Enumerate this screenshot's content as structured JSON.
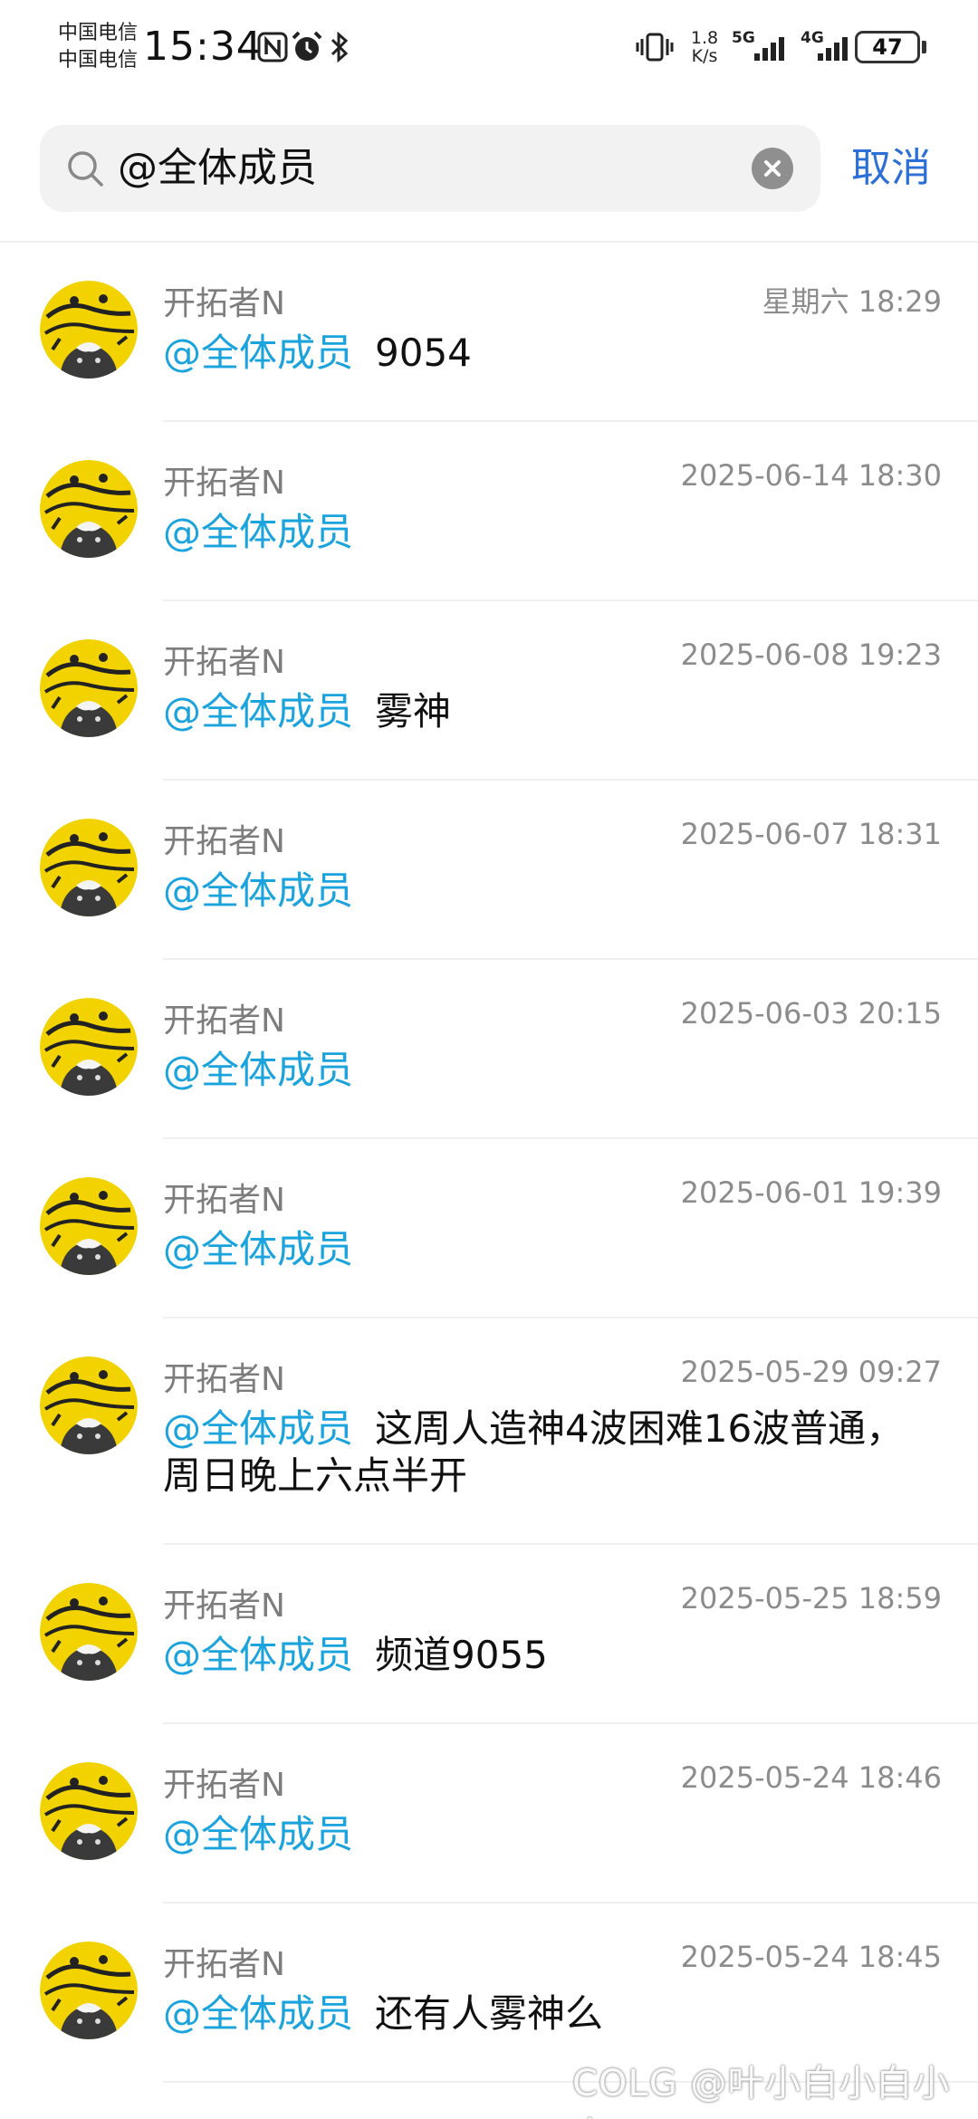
{
  "status_bar": {
    "carrier_1": "中国电信",
    "carrier_2": "中国电信",
    "time": "15:34",
    "net_speed_value": "1.8",
    "net_speed_unit": "K/s",
    "net_1": "5G",
    "net_2": "4G",
    "battery": "47"
  },
  "search": {
    "query": "@全体成员",
    "cancel_label": "取消"
  },
  "results": [
    {
      "sender": "开拓者N",
      "time": "星期六 18:29",
      "mention": "@全体成员",
      "text": "9054"
    },
    {
      "sender": "开拓者N",
      "time": "2025-06-14 18:30",
      "mention": "@全体成员",
      "text": ""
    },
    {
      "sender": "开拓者N",
      "time": "2025-06-08 19:23",
      "mention": "@全体成员",
      "text": "雾神"
    },
    {
      "sender": "开拓者N",
      "time": "2025-06-07 18:31",
      "mention": "@全体成员",
      "text": ""
    },
    {
      "sender": "开拓者N",
      "time": "2025-06-03 20:15",
      "mention": "@全体成员",
      "text": ""
    },
    {
      "sender": "开拓者N",
      "time": "2025-06-01 19:39",
      "mention": "@全体成员",
      "text": ""
    },
    {
      "sender": "开拓者N",
      "time": "2025-05-29 09:27",
      "mention": "@全体成员",
      "text": "这周人造神4波困难16波普通，周日晚上六点半开"
    },
    {
      "sender": "开拓者N",
      "time": "2025-05-25 18:59",
      "mention": "@全体成员",
      "text": "频道9055"
    },
    {
      "sender": "开拓者N",
      "time": "2025-05-24 18:46",
      "mention": "@全体成员",
      "text": ""
    },
    {
      "sender": "开拓者N",
      "time": "2025-05-24 18:45",
      "mention": "@全体成员",
      "text": "还有人雾神么"
    }
  ],
  "watermark": "COLG @叶小白小白小白",
  "colors": {
    "mention": "#1aa3dd",
    "cancel": "#2c6fd6",
    "avatar_bg": "#f2d300"
  }
}
